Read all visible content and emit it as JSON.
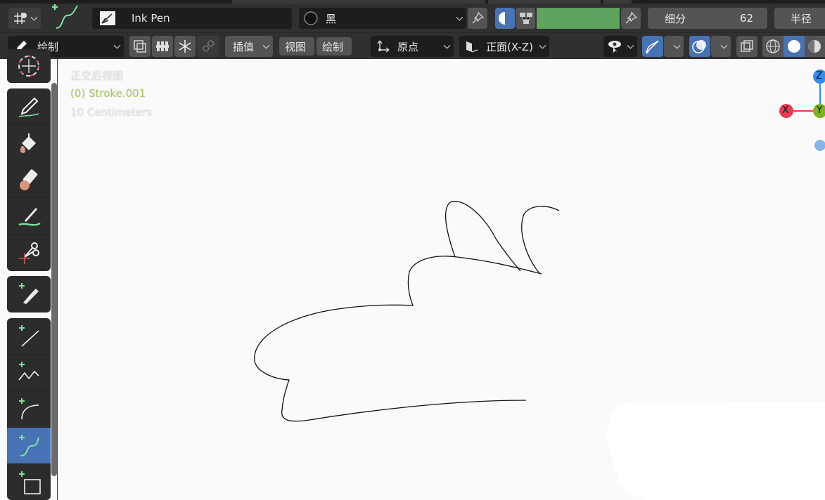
{
  "header": {
    "tool_name": "Ink Pen",
    "material": "黑",
    "subdivide_label": "细分",
    "subdivide_value": "62",
    "radius_label": "半径",
    "color_accent": "#5ea35e"
  },
  "toolbar": {
    "mode_label": "绘制",
    "interpolate_label": "插值",
    "view_label": "视图",
    "draw_label": "绘制",
    "origin_label": "原点",
    "plane_label": "正面(X-Z)"
  },
  "viewport": {
    "view_name": "正交后视图",
    "object_name": "(0) Stroke.001",
    "scale_label": "10 Centimeters",
    "object_color": "#a6cc5f"
  },
  "gizmo": {
    "z_label": "Z",
    "x_label": "X",
    "y_label": "Y",
    "colors": {
      "x": "#e63a55",
      "y": "#7ab51d",
      "z": "#2d8ef5",
      "neg_z": "#84b6ee"
    }
  },
  "tools": [
    "cursor-icon",
    "draw-icon",
    "fill-icon",
    "erase-icon",
    "tint-icon",
    "cutter-icon",
    "eyedropper-icon",
    "line-icon",
    "polyline-icon",
    "arc-icon",
    "curve-icon",
    "box-icon"
  ]
}
